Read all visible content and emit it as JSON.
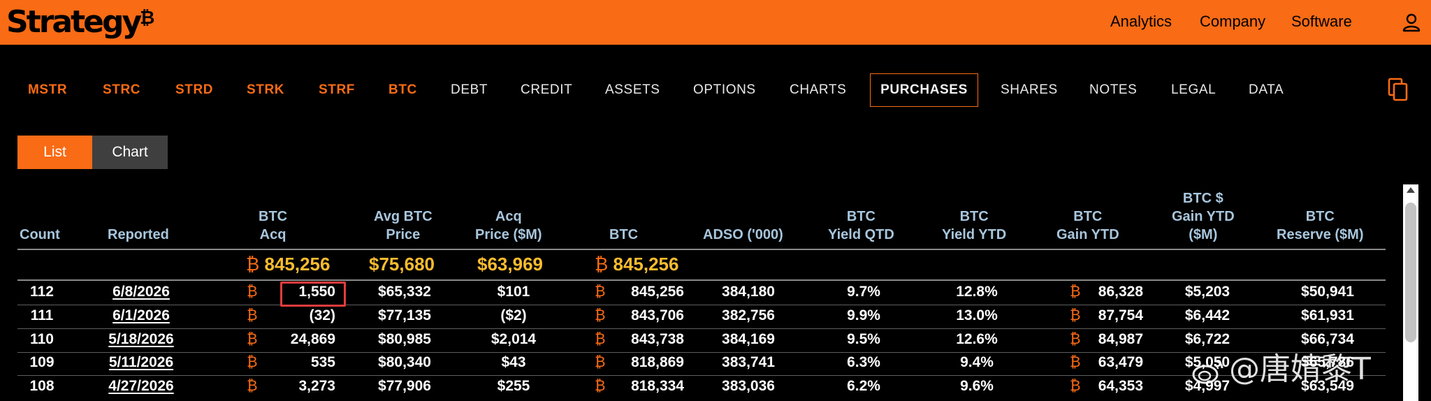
{
  "header": {
    "logo_text": "Strategy",
    "logo_symbol": "₿",
    "nav": [
      "Analytics",
      "Company",
      "Software"
    ],
    "user_icon": "user-icon"
  },
  "tabs": {
    "tickers": [
      "MSTR",
      "STRC",
      "STRD",
      "STRK",
      "STRF",
      "BTC"
    ],
    "sections": [
      "DEBT",
      "CREDIT",
      "ASSETS",
      "OPTIONS",
      "CHARTS",
      "PURCHASES",
      "SHARES",
      "NOTES",
      "LEGAL",
      "DATA"
    ],
    "active": "PURCHASES",
    "copy_icon": "copy-icon"
  },
  "view_toggle": {
    "list": "List",
    "chart": "Chart",
    "selected": "List"
  },
  "colors": {
    "brand": "#f96b15",
    "header_text": "#a8c6dd",
    "totals": "#fbbc2f",
    "highlight": "#e43c3c"
  },
  "table": {
    "btc_symbol": "₿",
    "columns": [
      [
        "Count"
      ],
      [
        "Reported"
      ],
      [
        "BTC",
        "Acq"
      ],
      [
        "Avg BTC",
        "Price"
      ],
      [
        "Acq",
        "Price ($M)"
      ],
      [
        "BTC"
      ],
      [
        "ADSO ('000)"
      ],
      [
        "BTC",
        "Yield QTD"
      ],
      [
        "BTC",
        "Yield YTD"
      ],
      [
        "BTC",
        "Gain YTD"
      ],
      [
        "BTC $",
        "Gain YTD",
        "($M)"
      ],
      [
        "BTC",
        "Reserve ($M)"
      ]
    ],
    "totals": {
      "btc_acq": "845,256",
      "avg_price": "$75,680",
      "acq_price": "$63,969",
      "btc": "845,256"
    },
    "rows": [
      {
        "count": "112",
        "reported": "6/8/2026",
        "btc_acq": "1,550",
        "avg_price": "$65,332",
        "acq_price": "$101",
        "btc": "845,256",
        "adso": "384,180",
        "yield_qtd": "9.7%",
        "yield_ytd": "12.8%",
        "gain_ytd": "86,328",
        "gain_usd": "$5,203",
        "reserve": "$50,941"
      },
      {
        "count": "111",
        "reported": "6/1/2026",
        "btc_acq": "(32)",
        "avg_price": "$77,135",
        "acq_price": "($2)",
        "btc": "843,706",
        "adso": "382,756",
        "yield_qtd": "9.9%",
        "yield_ytd": "13.0%",
        "gain_ytd": "87,754",
        "gain_usd": "$6,442",
        "reserve": "$61,931"
      },
      {
        "count": "110",
        "reported": "5/18/2026",
        "btc_acq": "24,869",
        "avg_price": "$80,985",
        "acq_price": "$2,014",
        "btc": "843,738",
        "adso": "384,169",
        "yield_qtd": "9.5%",
        "yield_ytd": "12.6%",
        "gain_ytd": "84,987",
        "gain_usd": "$6,722",
        "reserve": "$66,734"
      },
      {
        "count": "109",
        "reported": "5/11/2026",
        "btc_acq": "535",
        "avg_price": "$80,340",
        "acq_price": "$43",
        "btc": "818,869",
        "adso": "383,741",
        "yield_qtd": "6.3%",
        "yield_ytd": "9.4%",
        "gain_ytd": "63,479",
        "gain_usd": "$5,050",
        "reserve": "$65,786"
      },
      {
        "count": "108",
        "reported": "4/27/2026",
        "btc_acq": "3,273",
        "avg_price": "$77,906",
        "acq_price": "$255",
        "btc": "818,334",
        "adso": "383,036",
        "yield_qtd": "6.2%",
        "yield_ytd": "9.6%",
        "gain_ytd": "64,353",
        "gain_usd": "$4,997",
        "reserve": "$63,549"
      }
    ]
  },
  "watermark": {
    "text": "@唐婧黎T",
    "icon": "weibo-icon"
  }
}
